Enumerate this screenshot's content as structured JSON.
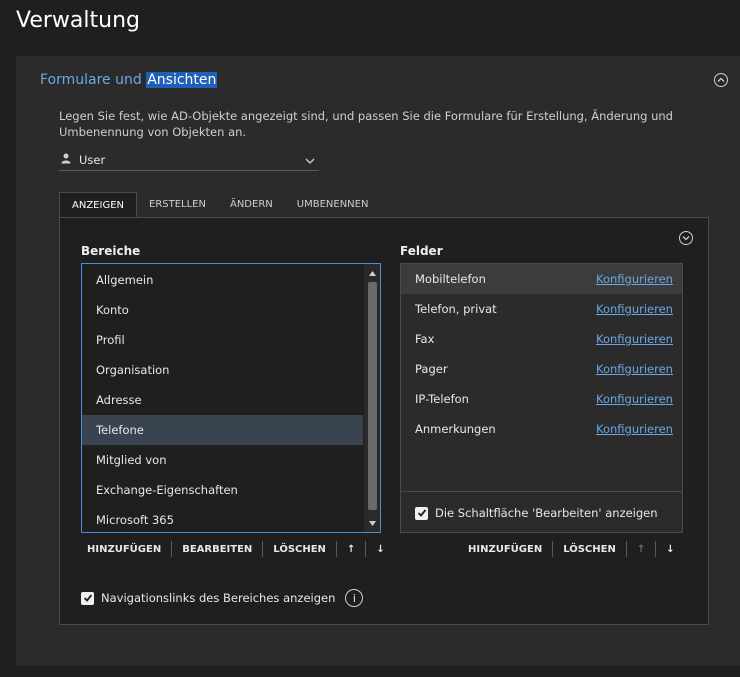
{
  "page": {
    "title": "Verwaltung"
  },
  "section": {
    "title_plain": "Formulare und ",
    "title_highlight": "Ansichten",
    "description": "Legen Sie fest, wie AD-Objekte angezeigt sind, und passen Sie die Formulare für Erstellung, Änderung und Umbenennung von Objekten an."
  },
  "object_select": {
    "value": "User"
  },
  "tabs": [
    {
      "label": "ANZEIGEN",
      "active": true
    },
    {
      "label": "ERSTELLEN",
      "active": false
    },
    {
      "label": "ÄNDERN",
      "active": false
    },
    {
      "label": "UMBENENNEN",
      "active": false
    }
  ],
  "areas": {
    "label": "Bereiche",
    "items": [
      "Allgemein",
      "Konto",
      "Profil",
      "Organisation",
      "Adresse",
      "Telefone",
      "Mitglied von",
      "Exchange-Eigenschaften",
      "Microsoft 365"
    ],
    "selected_index": 5,
    "buttons": {
      "add": "HINZUFÜGEN",
      "edit": "BEARBEITEN",
      "delete": "LÖSCHEN",
      "up": "↑",
      "down": "↓"
    }
  },
  "fields": {
    "label": "Felder",
    "items": [
      {
        "name": "Mobiltelefon",
        "action": "Konfigurieren"
      },
      {
        "name": "Telefon, privat",
        "action": "Konfigurieren"
      },
      {
        "name": "Fax",
        "action": "Konfigurieren"
      },
      {
        "name": "Pager",
        "action": "Konfigurieren"
      },
      {
        "name": "IP-Telefon",
        "action": "Konfigurieren"
      },
      {
        "name": "Anmerkungen",
        "action": "Konfigurieren"
      }
    ],
    "selected_index": 0,
    "edit_button_checkbox": {
      "label": "Die Schaltfläche 'Bearbeiten' anzeigen",
      "checked": true
    },
    "buttons": {
      "add": "HINZUFÜGEN",
      "delete": "LÖSCHEN",
      "up": "↑",
      "down": "↓"
    }
  },
  "nav_links_checkbox": {
    "label": "Navigationslinks des Bereiches anzeigen",
    "checked": true
  },
  "info_glyph": "i",
  "icons": [
    "chevron-up-circle-icon",
    "user-icon",
    "chevron-down-icon",
    "checkbox-checked-icon",
    "info-icon",
    "scroll-up-arrow-icon",
    "scroll-down-arrow-icon"
  ]
}
